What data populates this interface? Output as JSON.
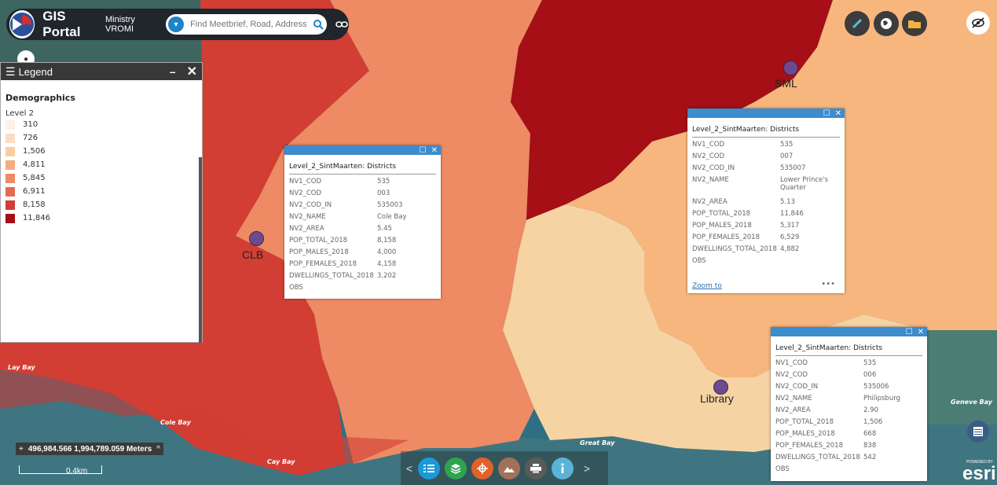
{
  "header": {
    "app_title": "GIS Portal",
    "org": "Ministry VROMI",
    "search_placeholder": "Find Meetbrief, Road, Address"
  },
  "legend": {
    "title": "Legend",
    "group": "Demographics",
    "level": "Level 2",
    "classes": [
      {
        "label": "310",
        "color": "#fdf0e4"
      },
      {
        "label": "726",
        "color": "#fbdcc2"
      },
      {
        "label": "1,506",
        "color": "#f8cfa1"
      },
      {
        "label": "4,811",
        "color": "#f4ad82"
      },
      {
        "label": "5,845",
        "color": "#ee8a64"
      },
      {
        "label": "6,911",
        "color": "#e66a52"
      },
      {
        "label": "8,158",
        "color": "#d23e34"
      },
      {
        "label": "11,846",
        "color": "#a50f15"
      }
    ]
  },
  "popups": [
    {
      "title": "Level_2_SintMaarten: Districts",
      "rows": [
        {
          "k": "NV1_COD",
          "v": "535"
        },
        {
          "k": "NV2_COD",
          "v": "003"
        },
        {
          "k": "NV2_COD_IN",
          "v": "535003"
        },
        {
          "k": "NV2_NAME",
          "v": "Cole Bay"
        },
        {
          "k": "NV2_AREA",
          "v": "5.45"
        },
        {
          "k": "POP_TOTAL_2018",
          "v": "8,158"
        },
        {
          "k": "POP_MALES_2018",
          "v": "4,000"
        },
        {
          "k": "POP_FEMALES_2018",
          "v": "4,158"
        },
        {
          "k": "DWELLINGS_TOTAL_2018",
          "v": "3,202"
        },
        {
          "k": "OBS",
          "v": ""
        }
      ]
    },
    {
      "title": "Level_2_SintMaarten: Districts",
      "rows": [
        {
          "k": "NV1_COD",
          "v": "535"
        },
        {
          "k": "NV2_COD",
          "v": "007"
        },
        {
          "k": "NV2_COD_IN",
          "v": "535007"
        },
        {
          "k": "NV2_NAME",
          "v": "Lower Prince's Quarter"
        },
        {
          "k": "NV2_AREA",
          "v": "5.13"
        },
        {
          "k": "POP_TOTAL_2018",
          "v": "11,846"
        },
        {
          "k": "POP_MALES_2018",
          "v": "5,317"
        },
        {
          "k": "POP_FEMALES_2018",
          "v": "6,529"
        },
        {
          "k": "DWELLINGS_TOTAL_2018",
          "v": "4,882"
        },
        {
          "k": "OBS",
          "v": ""
        }
      ],
      "zoom_label": "Zoom to",
      "more_label": "•••"
    },
    {
      "title": "Level_2_SintMaarten: Districts",
      "rows": [
        {
          "k": "NV1_COD",
          "v": "535"
        },
        {
          "k": "NV2_COD",
          "v": "006"
        },
        {
          "k": "NV2_COD_IN",
          "v": "535006"
        },
        {
          "k": "NV2_NAME",
          "v": "Philipsburg"
        },
        {
          "k": "NV2_AREA",
          "v": "2.90"
        },
        {
          "k": "POP_TOTAL_2018",
          "v": "1,506"
        },
        {
          "k": "POP_MALES_2018",
          "v": "668"
        },
        {
          "k": "POP_FEMALES_2018",
          "v": "838"
        },
        {
          "k": "DWELLINGS_TOTAL_2018",
          "v": "542"
        },
        {
          "k": "OBS",
          "v": ""
        }
      ]
    }
  ],
  "poi": {
    "clb": "CLB",
    "sml": "SML",
    "library": "Library"
  },
  "places": {
    "lay_bay": "Lay Bay",
    "cole_bay": "Cole Bay",
    "cay_bay": "Cay Bay",
    "great_bay": "Great Bay",
    "geneve_bay": "Geneve Bay"
  },
  "coords": {
    "text": "496,984.566 1,994,789.059 Meters",
    "plus": "+",
    "caret": "^"
  },
  "scale": {
    "label": "0.4km"
  },
  "toolbar": {
    "prev": "<",
    "next": ">"
  },
  "attribution": {
    "powered": "POWERED BY",
    "brand": "esri"
  },
  "colors": {
    "header_bg": "#20262b",
    "accent": "#1f83c6",
    "popup_header": "#3d8ccd",
    "water": "#2d6b80"
  }
}
